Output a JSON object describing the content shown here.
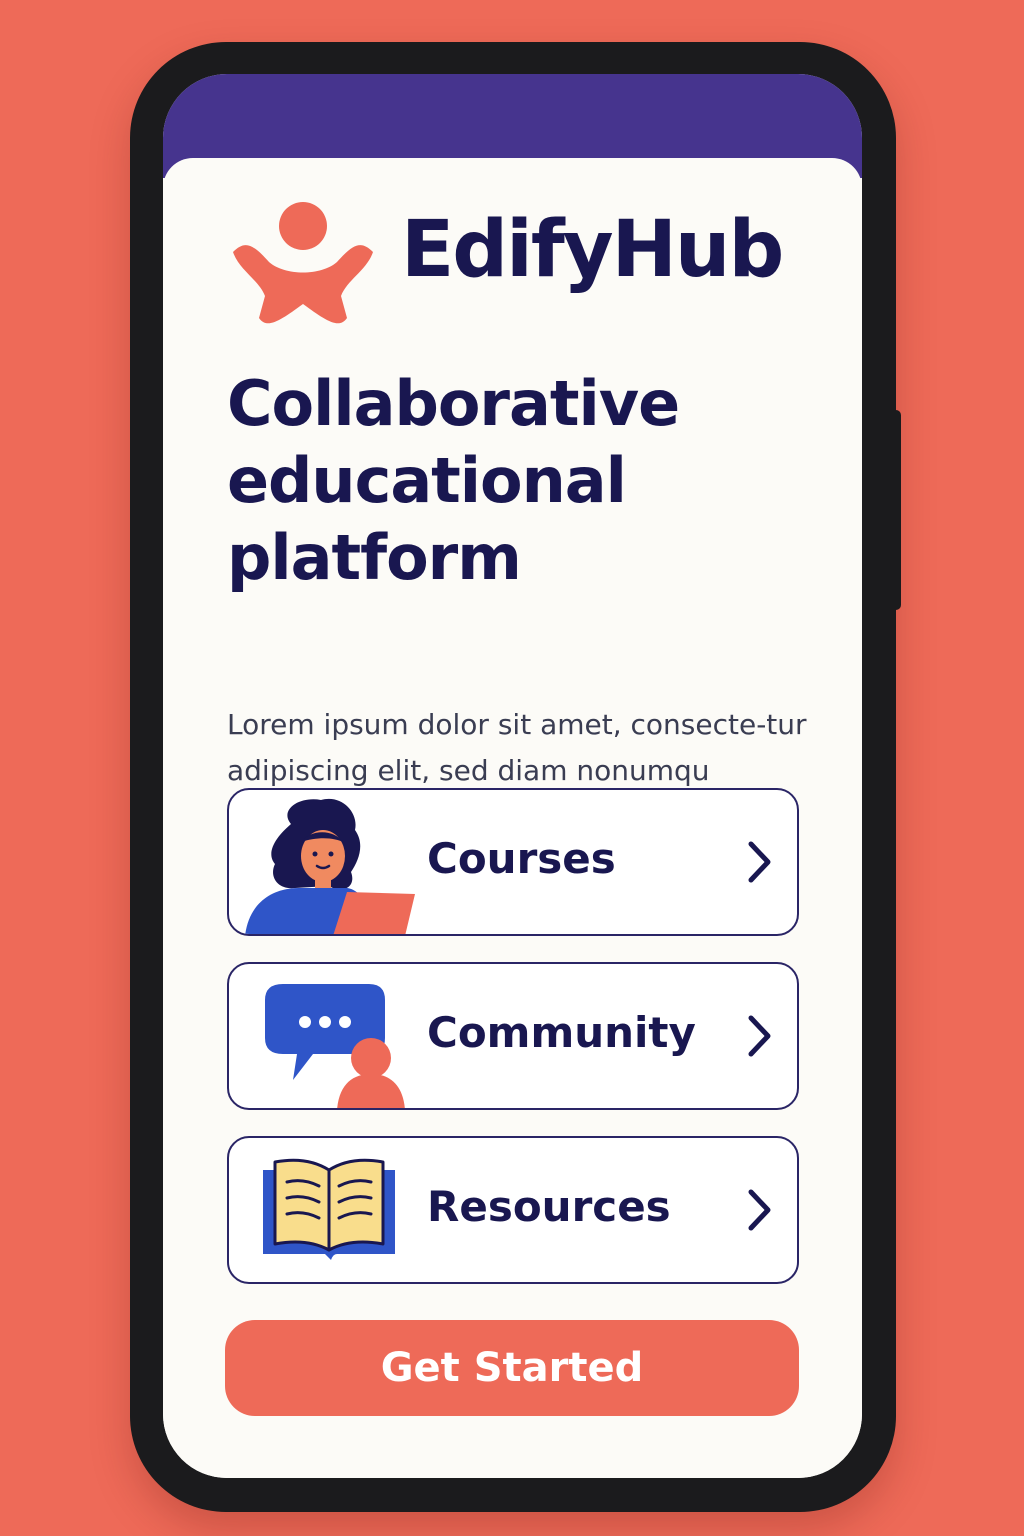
{
  "app": {
    "brand_name": "EdifyHub",
    "logo_icon": "person-arms-raised-icon"
  },
  "hero": {
    "headline": "Collaborative educational platform",
    "description": "Lorem ipsum dolor sit amet, consecte-tur adipiscing elit, sed diam nonumqu aulqusat."
  },
  "menu": {
    "items": [
      {
        "label": "Courses",
        "icon": "student-laptop-illustration"
      },
      {
        "label": "Community",
        "icon": "chat-bubble-person-illustration"
      },
      {
        "label": "Resources",
        "icon": "open-book-illustration"
      }
    ]
  },
  "cta": {
    "label": "Get Started"
  },
  "colors": {
    "background": "#EE6A58",
    "status_bar": "#46348E",
    "text_primary": "#191750",
    "accent": "#EE6A58",
    "blue": "#2F55C8",
    "book_page": "#F9DD8C"
  }
}
